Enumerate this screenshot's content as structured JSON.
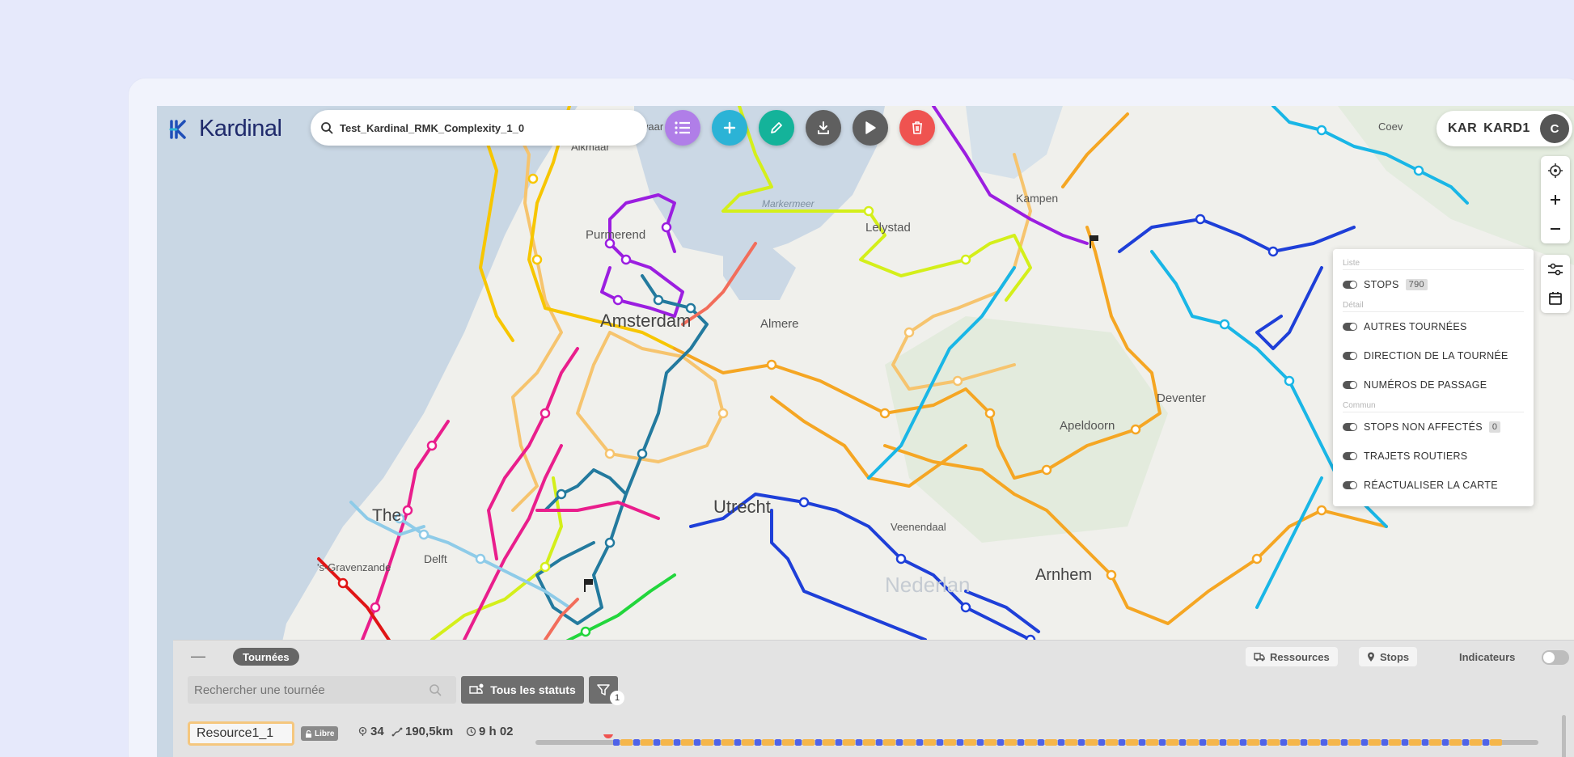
{
  "app": {
    "brand": "Kardinal"
  },
  "search": {
    "value": "Test_Kardinal_RMK_Complexity_1_0"
  },
  "toolbar": {
    "buttons": [
      {
        "name": "list-view-button",
        "icon": "list-icon",
        "color": "#b07ee8"
      },
      {
        "name": "add-button",
        "icon": "plus-icon",
        "color": "#2bb3d6"
      },
      {
        "name": "edit-button",
        "icon": "pencil-icon",
        "color": "#14b39a"
      },
      {
        "name": "download-button",
        "icon": "download-icon",
        "color": "#5f5f5f"
      },
      {
        "name": "play-button",
        "icon": "play-icon",
        "color": "#5f5f5f"
      },
      {
        "name": "delete-button",
        "icon": "trash-icon",
        "color": "#ef5350"
      }
    ]
  },
  "user": {
    "org": "KAR",
    "name": "KARD1",
    "initial": "C"
  },
  "map": {
    "place_labels": [
      "Purmerend",
      "Markermeer",
      "Lelystad",
      "Kampen",
      "Amsterdam",
      "Almere",
      "Deventer",
      "Apeldoorn",
      "The Hague",
      "Delft",
      "'s-Gravenzande",
      "Veenendaal",
      "Nederland",
      "Utrecht",
      "Arnhem",
      "Alkmaar",
      "Coevorden",
      "Zwaag"
    ],
    "visible_label_text": {
      "purmerend": "Purmerend",
      "markermeer": "Markermeer",
      "lelystad": "Lelystad",
      "kampen": "Kampen",
      "amsterdam": "Amsterdam",
      "almere": "Almere",
      "deventer": "Deventer",
      "apeldoorn": "Apeldoorn",
      "thehague": "The",
      "delft": "Delft",
      "gravenzande": "'s-Gravenzande",
      "veenendaal": "Veenendaal",
      "nederland": "Nederlan",
      "utrecht": "Utrecht",
      "arnhem": "Arnhem",
      "alkmaar": "Alkmaar",
      "coevorden": "Coev",
      "zwaag": "waar"
    }
  },
  "layer_panel": {
    "section_liste": "Liste",
    "stops_label": "STOPS",
    "stops_count": "790",
    "section_detail": "Détail",
    "autres_tournees": "AUTRES TOURNÉES",
    "direction": "DIRECTION DE LA TOURNÉE",
    "numeros": "NUMÉROS DE PASSAGE",
    "section_commun": "Commun",
    "non_affectes_label": "STOPS NON AFFECTÉS",
    "non_affectes_count": "0",
    "trajets": "TRAJETS ROUTIERS",
    "reactualiser": "RÉACTUALISER LA CARTE"
  },
  "bottom_panel": {
    "collapse_label": "—",
    "tab_label": "Tournées",
    "ressources_label": "Ressources",
    "stops_label": "Stops",
    "indicateurs_label": "Indicateurs",
    "route_search_placeholder": "Rechercher une tournée",
    "status_filter_label": "Tous les statuts",
    "filter_count": "1",
    "resource": {
      "name": "Resource1_1",
      "status": "Libre",
      "stops": "34",
      "distance": "190,5km",
      "duration": "9 h 02"
    }
  },
  "colors": {
    "accent_purple": "#b07ee8",
    "accent_cyan": "#2bb3d6",
    "accent_teal": "#14b39a",
    "accent_red": "#ef5350",
    "route_orange": "#f5a623",
    "route_blue": "#1e3fd8",
    "route_teal": "#237a9e",
    "route_pink": "#e91e8c",
    "route_lime": "#d4ef1a",
    "route_violet": "#9b1ee0",
    "route_yellow": "#f7c600",
    "route_sky": "#19b6e6",
    "route_green": "#22d63c",
    "route_red": "#e01515",
    "route_light_orange": "#f6c46e",
    "route_light_blue": "#8ecbe8"
  }
}
